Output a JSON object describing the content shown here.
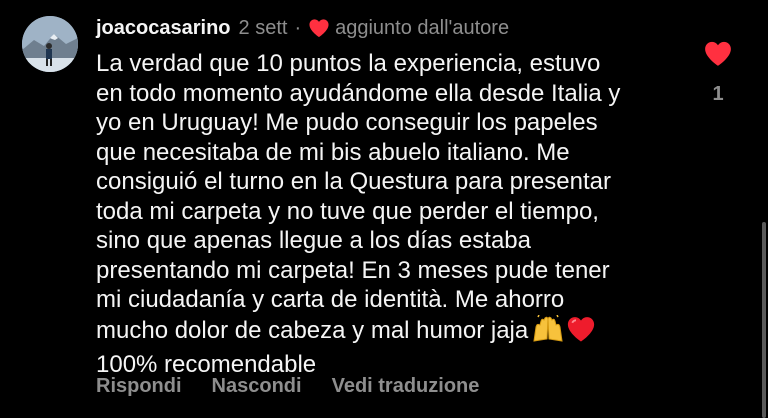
{
  "comment": {
    "username": "joacocasarino",
    "time": "2 sett",
    "separator": "·",
    "liked_by_author": "aggiunto dall'autore",
    "lines": [
      "La verdad que 10 puntos la experiencia, estuvo",
      "en todo momento ayudándome ella desde Italia y",
      "yo en Uruguay! Me pudo conseguir los papeles",
      "que necesitaba de mi bis abuelo italiano. Me",
      "consiguió el turno en la Questura para presentar",
      "toda mi carpeta y no tuve que perder el tiempo,",
      "sino que apenas llegue a los días estaba",
      "presentando mi carpeta! En 3 meses pude tener",
      "mi ciudadanía y carta de identità. Me ahorro",
      "mucho dolor de cabeza y mal humor jaja",
      "100% recomendable"
    ],
    "emojis": [
      "raising-hands-emoji",
      "red-heart-emoji"
    ],
    "like_count": "1"
  },
  "actions": {
    "reply": "Rispondi",
    "hide": "Nascondi",
    "translate": "Vedi traduzione"
  },
  "colors": {
    "background": "#000000",
    "text": "#f5f5f5",
    "secondary": "#8e8e8e",
    "heart": "#ff3040"
  }
}
